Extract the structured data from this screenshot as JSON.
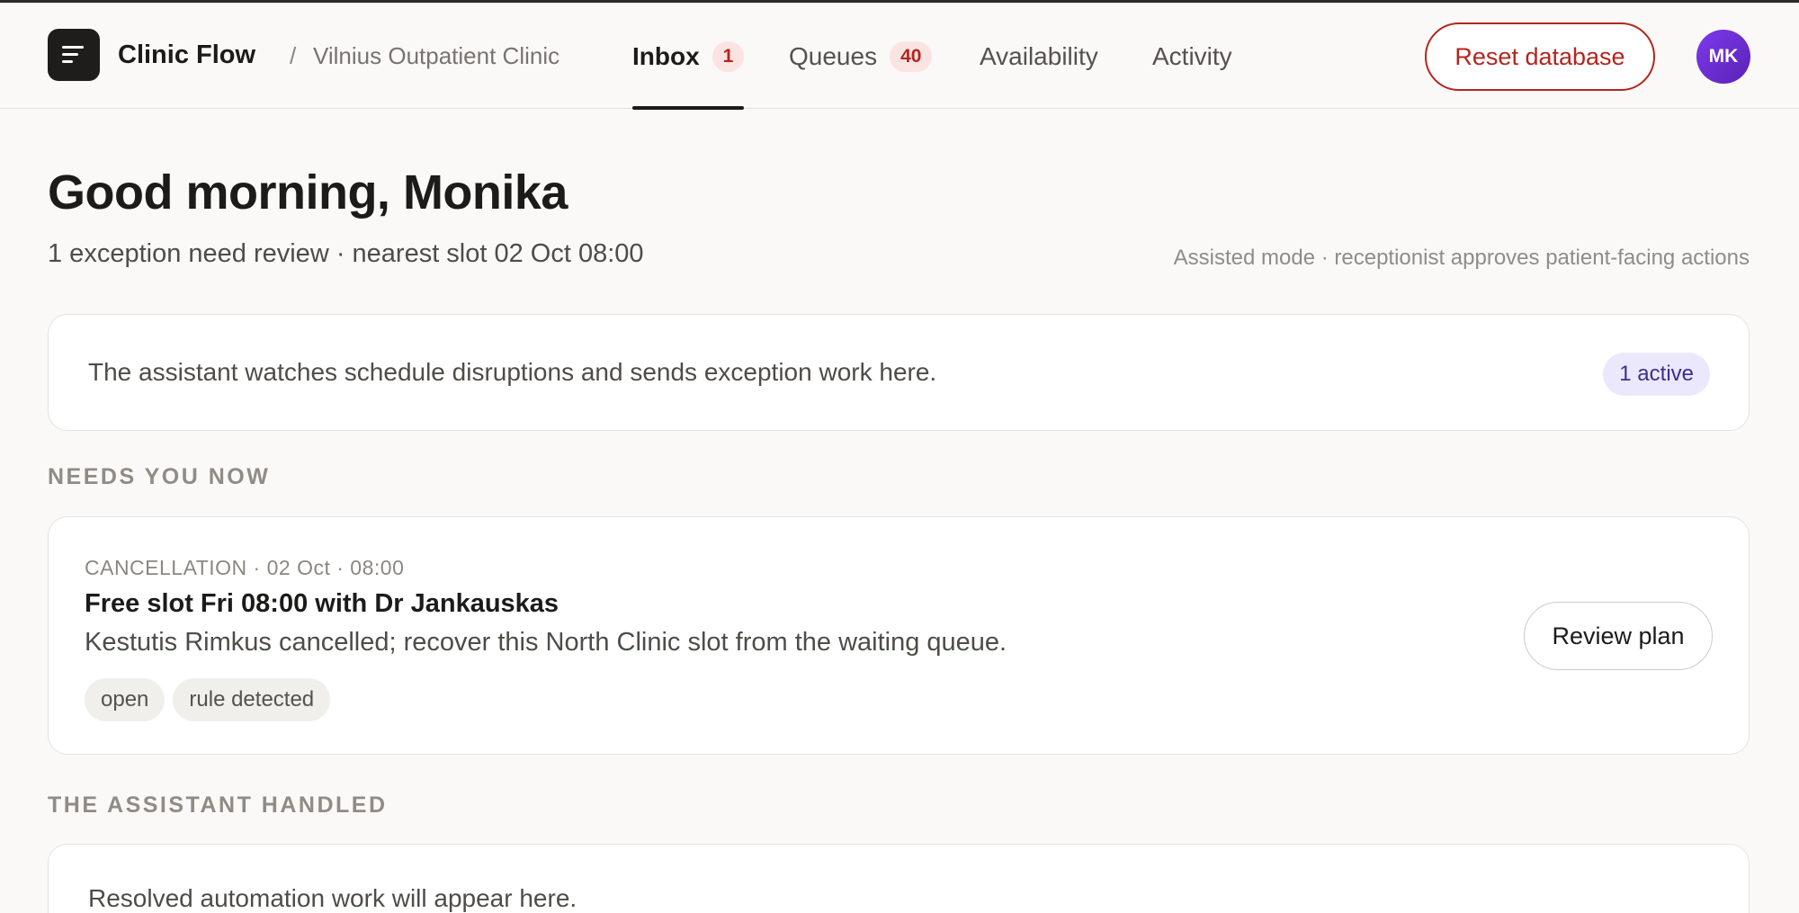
{
  "header": {
    "app_name": "Clinic Flow",
    "breadcrumb_separator": "/",
    "clinic_name": "Vilnius Outpatient Clinic",
    "tabs": [
      {
        "label": "Inbox",
        "badge": "1"
      },
      {
        "label": "Queues",
        "badge": "40"
      },
      {
        "label": "Availability"
      },
      {
        "label": "Activity"
      }
    ],
    "reset_label": "Reset database",
    "avatar_initials": "MK"
  },
  "greeting": {
    "title": "Good morning, Monika",
    "subtitle": "1 exception need review · nearest slot 02 Oct 08:00",
    "mode_note": "Assisted mode · receptionist approves patient-facing actions"
  },
  "info_card": {
    "text": "The assistant watches schedule disruptions and sends exception work here.",
    "status": "1 active"
  },
  "needs_now": {
    "section_title": "NEEDS YOU NOW",
    "items": [
      {
        "meta": "CANCELLATION · 02 Oct · 08:00",
        "title": "Free slot Fri 08:00 with Dr Jankauskas",
        "description": "Kestutis Rimkus cancelled; recover this North Clinic slot from the waiting queue.",
        "tags": [
          "open",
          "rule detected"
        ],
        "action_label": "Review plan"
      }
    ]
  },
  "handled": {
    "section_title": "THE ASSISTANT HANDLED",
    "empty_text": "Resolved automation work will appear here."
  },
  "colors": {
    "accent_red": "#b3261e",
    "avatar_purple": "#6d28d9",
    "active_pill_bg": "#ece8fc"
  }
}
